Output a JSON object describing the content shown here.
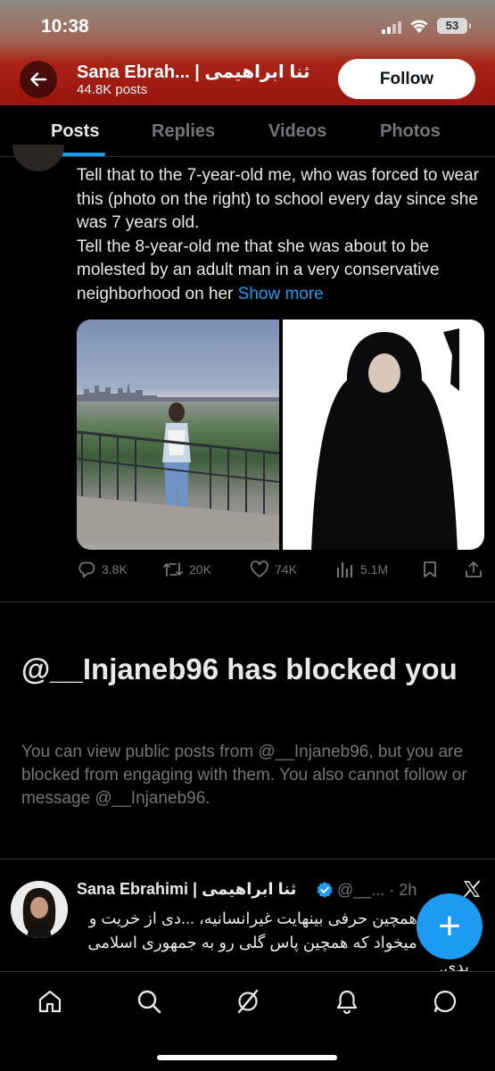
{
  "status_bar": {
    "time": "10:38",
    "battery": "53"
  },
  "header": {
    "back_icon": "arrow-left-icon",
    "profile_name": "Sana Ebrah... | ثنا ابراهیمی",
    "post_count": "44.8K posts",
    "follow_label": "Follow"
  },
  "tabs": [
    {
      "label": "Posts",
      "active": true
    },
    {
      "label": "Replies",
      "active": false
    },
    {
      "label": "Videos",
      "active": false
    },
    {
      "label": "Photos",
      "active": false
    }
  ],
  "tweet1": {
    "lines": [
      "Tell that to the 7-year-old me, who was forced to wear this (photo on the right) to school every day since she was 7 years old.",
      "Tell the 8-year-old me that she was about to be molested by an adult man in a very conservative neighborhood on her"
    ],
    "show_more": "Show more",
    "stats": {
      "replies": "3.8K",
      "reposts": "20K",
      "likes": "74K",
      "views": "5.1M"
    }
  },
  "blocked": {
    "title": "@__Injaneb96 has blocked you",
    "body": "You can view public posts from @__Injaneb96, but you are blocked from engaging with them. You also cannot follow or message @__Injaneb96."
  },
  "tweet2": {
    "name": "Sana Ebrahimi | ثنا ابراهیمی",
    "handle": "@__...",
    "time": "· 2h",
    "text": "که زدن همچین حرفی بینهایت غیرانسانیه، ...دی از خریت و حماقت میخواد که همچین پاس گلی رو به جمهوری اسلامی بدی."
  },
  "bottom_nav": [
    "home-icon",
    "search-icon",
    "grok-icon",
    "notifications-icon",
    "messages-icon"
  ],
  "colors": {
    "accent": "#1d9bf0",
    "background": "#000000",
    "muted": "#71767b",
    "header_red": "#a82216"
  }
}
